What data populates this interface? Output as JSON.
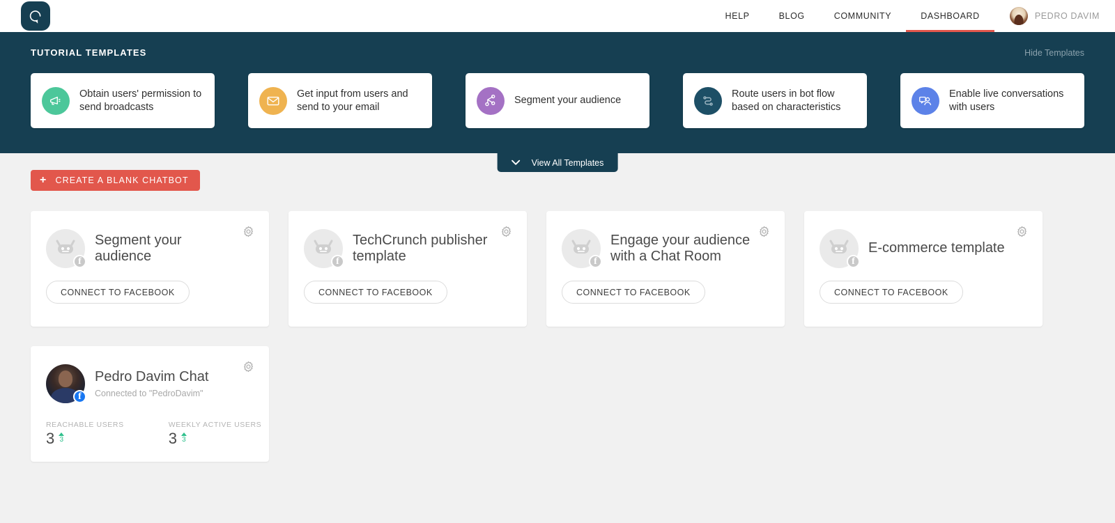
{
  "brand": {
    "logo_icon": "speech-bubble-logo",
    "logo_color": "#163f52",
    "accent_color": "#e2574c",
    "panel_color": "#163f52"
  },
  "nav": {
    "links": [
      {
        "label": "HELP",
        "active": false
      },
      {
        "label": "BLOG",
        "active": false
      },
      {
        "label": "COMMUNITY",
        "active": false
      },
      {
        "label": "DASHBOARD",
        "active": true
      }
    ],
    "user": {
      "name": "PEDRO DAVIM",
      "avatar_icon": "user-avatar-photo"
    }
  },
  "templates_panel": {
    "title": "TUTORIAL TEMPLATES",
    "hide_label": "Hide Templates",
    "view_all_label": "View All Templates",
    "view_all_icon": "chevron-down-icon",
    "cards": [
      {
        "label": "Obtain users' permission to send broadcasts",
        "icon": "megaphone-icon",
        "color": "#4cc79a"
      },
      {
        "label": "Get input from users and send to your email",
        "icon": "envelope-icon",
        "color": "#efb350"
      },
      {
        "label": "Segment your audience",
        "icon": "share-branch-icon",
        "color": "#a471c4"
      },
      {
        "label": "Route users in bot flow based on characteristics",
        "icon": "flow-route-icon",
        "color": "#1d4f66"
      },
      {
        "label": "Enable live conversations with users",
        "icon": "live-chat-users-icon",
        "color": "#5c82e8"
      }
    ]
  },
  "main": {
    "create_button": {
      "label": "CREATE A BLANK CHATBOT",
      "icon": "plus-icon"
    },
    "bots": [
      {
        "title": "Segment your audience",
        "subtitle": "",
        "avatar_icon": "robot-avatar-icon",
        "channel_badge": "facebook-badge",
        "connected": false,
        "action_label": "CONNECT TO FACEBOOK",
        "settings_icon": "gear-icon"
      },
      {
        "title": "TechCrunch publisher template",
        "subtitle": "",
        "avatar_icon": "robot-avatar-icon",
        "channel_badge": "facebook-badge",
        "connected": false,
        "action_label": "CONNECT TO FACEBOOK",
        "settings_icon": "gear-icon"
      },
      {
        "title": "Engage your audience with a Chat Room",
        "subtitle": "",
        "avatar_icon": "robot-avatar-icon",
        "channel_badge": "facebook-badge",
        "connected": false,
        "action_label": "CONNECT TO FACEBOOK",
        "settings_icon": "gear-icon"
      },
      {
        "title": "E-commerce template",
        "subtitle": "",
        "avatar_icon": "robot-avatar-icon",
        "channel_badge": "facebook-badge",
        "connected": false,
        "action_label": "CONNECT TO FACEBOOK",
        "settings_icon": "gear-icon"
      },
      {
        "title": "Pedro Davim Chat",
        "subtitle": "Connected to \"PedroDavim\"",
        "avatar_icon": "user-photo-avatar",
        "channel_badge": "facebook-badge",
        "connected": true,
        "settings_icon": "gear-icon",
        "stats": [
          {
            "label": "REACHABLE USERS",
            "value": "3",
            "delta": "3",
            "trend": "up",
            "trend_color": "#2ec08c"
          },
          {
            "label": "WEEKLY ACTIVE USERS",
            "value": "3",
            "delta": "3",
            "trend": "up",
            "trend_color": "#2ec08c"
          }
        ]
      }
    ]
  }
}
